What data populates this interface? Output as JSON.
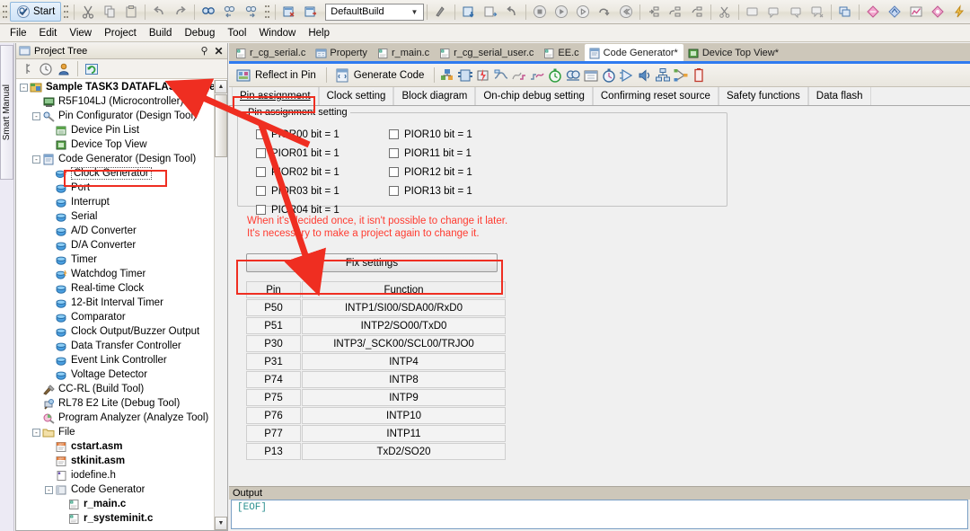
{
  "toolbar": {
    "start_label": "Start",
    "build_config": "DefaultBuild",
    "icons_left": [
      "cut-icon",
      "copy-icon",
      "paste-icon",
      "undo-icon",
      "redo-icon",
      "find-icon",
      "find-prev-icon",
      "find-next-icon"
    ],
    "icons_right": [
      "build-icon",
      "build-project-icon",
      "rebuild-icon",
      "download-icon",
      "stop-icon",
      "run-icon",
      "step-run-icon",
      "step-over-icon",
      "restart-icon",
      "step-in-icon",
      "step-out-icon",
      "step-return-icon",
      "cpu-reset-icon",
      "break-icon",
      "watch-icon",
      "watch-add-icon",
      "watch-remove-icon",
      "memory-icon",
      "tile-icon",
      "property-icon",
      "analyze-icon",
      "trace-icon",
      "chart-icon",
      "profile-icon",
      "flash-icon"
    ]
  },
  "menubar": {
    "items": [
      "File",
      "Edit",
      "View",
      "Project",
      "Build",
      "Debug",
      "Tool",
      "Window",
      "Help"
    ]
  },
  "leftstrip": {
    "smart_manual": "Smart Manual"
  },
  "tree_panel": {
    "title": "Project Tree",
    "pin_icon": "pin-icon",
    "close_icon": "close-icon",
    "tool_icons": [
      "connect-icon",
      "clock-icon",
      "user-icon",
      "refresh-icon"
    ],
    "nodes": [
      {
        "label": "Sample TASK3 DATAFLASH (Projec",
        "indent": 0,
        "expander": "-",
        "icon": "project-icon",
        "bold": true,
        "selected": false
      },
      {
        "label": "R5F104LJ (Microcontroller)",
        "indent": 1,
        "expander": "",
        "icon": "mcu-icon",
        "bold": false,
        "selected": false
      },
      {
        "label": "Pin Configurator (Design Tool)",
        "indent": 1,
        "expander": "-",
        "icon": "pinconfig-icon",
        "bold": false,
        "selected": false
      },
      {
        "label": "Device Pin List",
        "indent": 2,
        "expander": "",
        "icon": "pinlist-icon",
        "bold": false,
        "selected": false
      },
      {
        "label": "Device Top View",
        "indent": 2,
        "expander": "",
        "icon": "topview-icon",
        "bold": false,
        "selected": false
      },
      {
        "label": "Code Generator (Design Tool)",
        "indent": 1,
        "expander": "-",
        "icon": "codegen-icon",
        "bold": false,
        "selected": false
      },
      {
        "label": "Clock Generator",
        "indent": 2,
        "expander": "",
        "icon": "clockgen-icon",
        "bold": false,
        "selected": true
      },
      {
        "label": "Port",
        "indent": 2,
        "expander": "",
        "icon": "peripheral-icon",
        "bold": false,
        "selected": false
      },
      {
        "label": "Interrupt",
        "indent": 2,
        "expander": "",
        "icon": "peripheral-icon",
        "bold": false,
        "selected": false
      },
      {
        "label": "Serial",
        "indent": 2,
        "expander": "",
        "icon": "peripheral-icon",
        "bold": false,
        "selected": false
      },
      {
        "label": "A/D Converter",
        "indent": 2,
        "expander": "",
        "icon": "peripheral-icon",
        "bold": false,
        "selected": false
      },
      {
        "label": "D/A Converter",
        "indent": 2,
        "expander": "",
        "icon": "peripheral-icon",
        "bold": false,
        "selected": false
      },
      {
        "label": "Timer",
        "indent": 2,
        "expander": "",
        "icon": "peripheral-icon",
        "bold": false,
        "selected": false
      },
      {
        "label": "Watchdog Timer",
        "indent": 2,
        "expander": "",
        "icon": "peripheral-alt-icon",
        "bold": false,
        "selected": false
      },
      {
        "label": "Real-time Clock",
        "indent": 2,
        "expander": "",
        "icon": "peripheral-icon",
        "bold": false,
        "selected": false
      },
      {
        "label": "12-Bit Interval Timer",
        "indent": 2,
        "expander": "",
        "icon": "peripheral-icon",
        "bold": false,
        "selected": false
      },
      {
        "label": "Comparator",
        "indent": 2,
        "expander": "",
        "icon": "peripheral-icon",
        "bold": false,
        "selected": false
      },
      {
        "label": "Clock Output/Buzzer Output",
        "indent": 2,
        "expander": "",
        "icon": "peripheral-icon",
        "bold": false,
        "selected": false
      },
      {
        "label": "Data Transfer Controller",
        "indent": 2,
        "expander": "",
        "icon": "peripheral-icon",
        "bold": false,
        "selected": false
      },
      {
        "label": "Event Link Controller",
        "indent": 2,
        "expander": "",
        "icon": "peripheral-icon",
        "bold": false,
        "selected": false
      },
      {
        "label": "Voltage Detector",
        "indent": 2,
        "expander": "",
        "icon": "peripheral-icon",
        "bold": false,
        "selected": false
      },
      {
        "label": "CC-RL (Build Tool)",
        "indent": 1,
        "expander": "",
        "icon": "build-tool-icon",
        "bold": false,
        "selected": false
      },
      {
        "label": "RL78 E2 Lite (Debug Tool)",
        "indent": 1,
        "expander": "",
        "icon": "debug-tool-icon",
        "bold": false,
        "selected": false
      },
      {
        "label": "Program Analyzer (Analyze Tool)",
        "indent": 1,
        "expander": "",
        "icon": "analyze-tool-icon",
        "bold": false,
        "selected": false
      },
      {
        "label": "File",
        "indent": 1,
        "expander": "-",
        "icon": "folder-icon",
        "bold": false,
        "selected": false
      },
      {
        "label": "cstart.asm",
        "indent": 2,
        "expander": "",
        "icon": "asm-file-icon",
        "bold": true,
        "selected": false
      },
      {
        "label": "stkinit.asm",
        "indent": 2,
        "expander": "",
        "icon": "asm-file-icon",
        "bold": true,
        "selected": false
      },
      {
        "label": "iodefine.h",
        "indent": 2,
        "expander": "",
        "icon": "header-file-icon",
        "bold": false,
        "selected": false
      },
      {
        "label": "Code Generator",
        "indent": 2,
        "expander": "-",
        "icon": "folder-plain-icon",
        "bold": false,
        "selected": false
      },
      {
        "label": "r_main.c",
        "indent": 3,
        "expander": "",
        "icon": "c-file-icon",
        "bold": true,
        "selected": false
      },
      {
        "label": "r_systeminit.c",
        "indent": 3,
        "expander": "",
        "icon": "c-file-icon",
        "bold": true,
        "selected": false
      }
    ]
  },
  "doc_tabs": [
    {
      "label": "r_cg_serial.c",
      "icon": "c-file-icon",
      "active": false
    },
    {
      "label": "Property",
      "icon": "property-icon",
      "active": false
    },
    {
      "label": "r_main.c",
      "icon": "c-file-icon",
      "active": false
    },
    {
      "label": "r_cg_serial_user.c",
      "icon": "c-file-icon",
      "active": false
    },
    {
      "label": "EE.c",
      "icon": "c-file-icon",
      "active": false
    },
    {
      "label": "Code Generator*",
      "icon": "codegen-icon",
      "active": true
    },
    {
      "label": "Device Top View*",
      "icon": "topview-icon",
      "active": false
    }
  ],
  "cg_toolbar": {
    "reflect_in_pin": "Reflect in Pin",
    "generate_code": "Generate Code",
    "icons": [
      "clock-generator-icon",
      "port-icon",
      "interrupt-icon",
      "serial-icon",
      "ad-converter-icon",
      "da-converter-icon",
      "timer-icon",
      "watchdog-icon",
      "rtc-icon",
      "interval-timer-icon",
      "comparator-icon",
      "buzzer-icon",
      "dtc-icon",
      "elc-icon",
      "voltage-detector-icon"
    ]
  },
  "inner_tabs": [
    {
      "label": "Pin assignment",
      "active": true
    },
    {
      "label": "Clock setting",
      "active": false
    },
    {
      "label": "Block diagram",
      "active": false
    },
    {
      "label": "On-chip debug setting",
      "active": false
    },
    {
      "label": "Confirming reset source",
      "active": false
    },
    {
      "label": "Safety functions",
      "active": false
    },
    {
      "label": "Data flash",
      "active": false
    }
  ],
  "pin_assignment": {
    "group_title": "Pin assignment setting",
    "checkbox_rows": [
      {
        "left": {
          "label": "PIOR00 bit = 1",
          "checked": false
        },
        "right": {
          "label": "PIOR10 bit = 1",
          "checked": false
        }
      },
      {
        "left": {
          "label": "PIOR01 bit = 1",
          "checked": false
        },
        "right": {
          "label": "PIOR11 bit = 1",
          "checked": false
        }
      },
      {
        "left": {
          "label": "PIOR02 bit = 1",
          "checked": false
        },
        "right": {
          "label": "PIOR12 bit = 1",
          "checked": false
        }
      },
      {
        "left": {
          "label": "PIOR03 bit = 1",
          "checked": false
        },
        "right": {
          "label": "PIOR13 bit = 1",
          "checked": false
        }
      },
      {
        "left": {
          "label": "PIOR04 bit = 1",
          "checked": false
        },
        "right": {
          "label": "",
          "checked": false
        }
      }
    ],
    "warning_line1": "When it's decided once, it isn't possible to change it later.",
    "warning_line2": "It's necessary to make a project again to change it.",
    "warning_color": "#ff3b30",
    "fix_settings_label": "Fix settings",
    "table": {
      "headers": [
        "Pin",
        "Function"
      ],
      "rows": [
        [
          "P50",
          "INTP1/SI00/SDA00/RxD0"
        ],
        [
          "P51",
          "INTP2/SO00/TxD0"
        ],
        [
          "P30",
          "INTP3/_SCK00/SCL00/TRJO0"
        ],
        [
          "P31",
          "INTP4"
        ],
        [
          "P74",
          "INTP8"
        ],
        [
          "P75",
          "INTP9"
        ],
        [
          "P76",
          "INTP10"
        ],
        [
          "P77",
          "INTP11"
        ],
        [
          "P13",
          "TxD2/SO20"
        ]
      ]
    }
  },
  "output_panel": {
    "title": "Output",
    "content": "[EOF]"
  },
  "annotations": {
    "accent_color": "#ef2e21",
    "boxes": [
      "clock-generator-node",
      "pin-assignment-tab",
      "fix-settings-button"
    ],
    "arrows": [
      "arrow-to-project-tree",
      "arrow-to-fix-settings"
    ]
  }
}
